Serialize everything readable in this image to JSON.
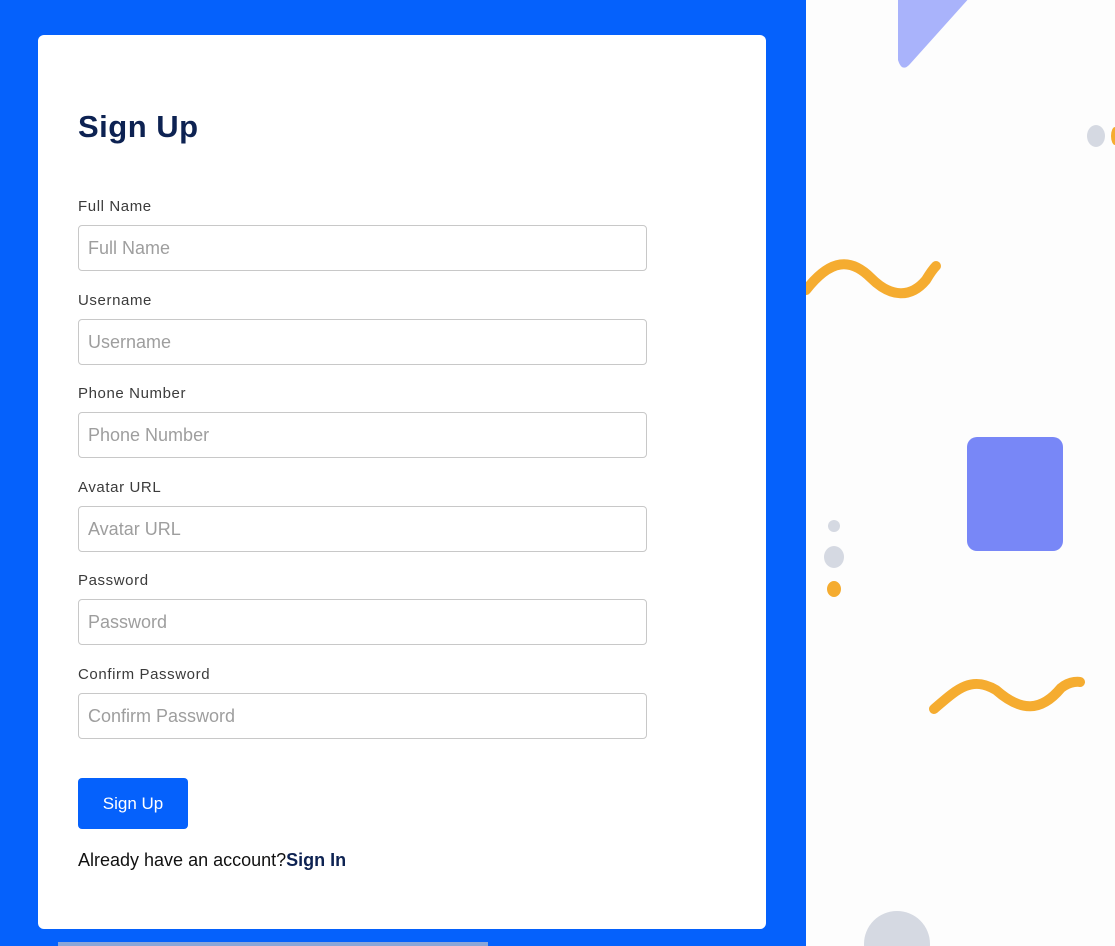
{
  "form": {
    "title": "Sign Up",
    "fields": [
      {
        "label": "Full Name",
        "placeholder": "Full Name",
        "value": ""
      },
      {
        "label": "Username",
        "placeholder": "Username",
        "value": ""
      },
      {
        "label": "Phone Number",
        "placeholder": "Phone Number",
        "value": ""
      },
      {
        "label": "Avatar URL",
        "placeholder": "Avatar URL",
        "value": ""
      },
      {
        "label": "Password",
        "placeholder": "Password",
        "value": ""
      },
      {
        "label": "Confirm Password",
        "placeholder": "Confirm Password",
        "value": ""
      }
    ],
    "submit_label": "Sign Up",
    "signin_prompt": "Already have an account?",
    "signin_link": "Sign In"
  },
  "colors": {
    "brand_blue": "#0561fc",
    "title_navy": "#0d2252",
    "accent_orange": "#f5ac30",
    "shape_purple": "#7887f7",
    "shape_lavender": "#a9b3fb",
    "shape_gray": "#d5d9e2"
  }
}
